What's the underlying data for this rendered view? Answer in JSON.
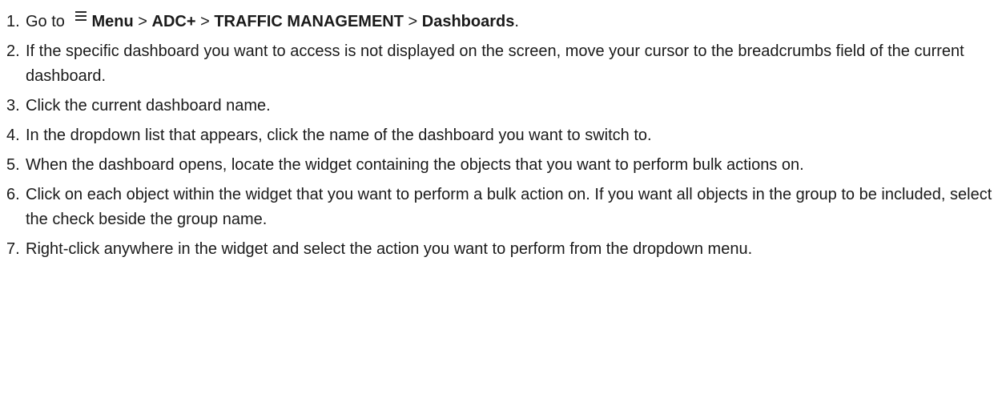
{
  "steps": [
    {
      "number": "1.",
      "prefix": "Go to",
      "icon": "menu-icon",
      "path": [
        {
          "text": "Menu",
          "bold": true
        },
        {
          "text": " > ",
          "bold": false
        },
        {
          "text": "ADC+",
          "bold": true
        },
        {
          "text": " > ",
          "bold": false
        },
        {
          "text": "TRAFFIC MANAGEMENT",
          "bold": true
        },
        {
          "text": " > ",
          "bold": false
        },
        {
          "text": "Dashboards",
          "bold": true
        },
        {
          "text": ".",
          "bold": false
        }
      ]
    },
    {
      "number": "2.",
      "text": "If the specific dashboard you want to access is not displayed on the screen, move your cursor to the breadcrumbs field of the current dashboard."
    },
    {
      "number": "3.",
      "text": "Click the current dashboard name."
    },
    {
      "number": "4.",
      "text": "In the dropdown list that appears, click the name of the dashboard you want to switch to."
    },
    {
      "number": "5.",
      "text": "When the dashboard opens, locate the widget containing the objects that you want to perform bulk actions on."
    },
    {
      "number": "6.",
      "text": "Click on each object within the widget that you want to perform a bulk action on. If you want all objects in the group to be included, select the check beside the group name."
    },
    {
      "number": "7.",
      "text": "Right-click anywhere in the widget and select the action you want to perform from the dropdown menu."
    }
  ]
}
